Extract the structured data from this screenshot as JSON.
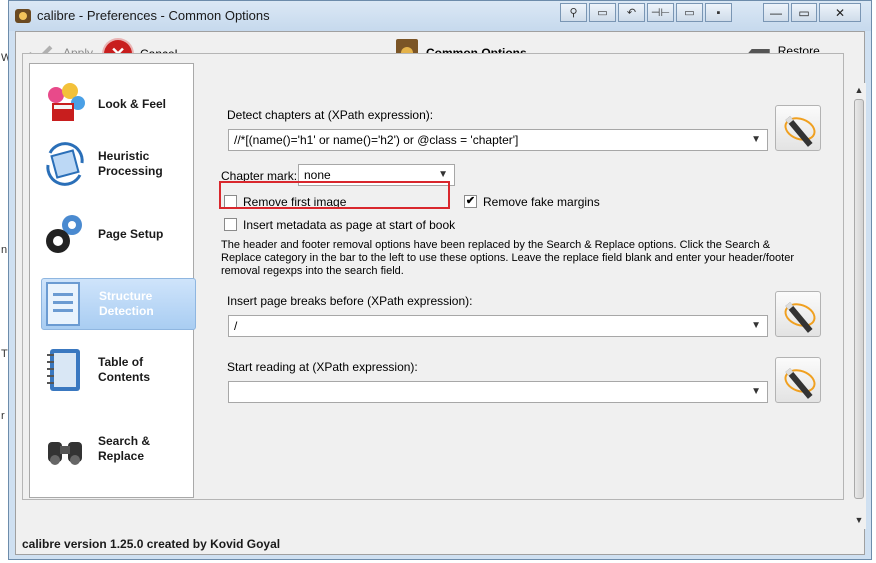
{
  "window": {
    "title": "calibre - Preferences - Common Options",
    "tools": [
      "⚲",
      "▭",
      "↶",
      "⊣⊢",
      "▭",
      "▪"
    ],
    "controls": {
      "minimize": "—",
      "maximize": "▭",
      "close": "✕"
    }
  },
  "toolbar": {
    "apply_label": "Apply",
    "cancel_label": "Cancel",
    "section_title": "Common Options",
    "restore_label": "Restore defaults"
  },
  "sidebar": {
    "items": [
      {
        "label": "Look & Feel"
      },
      {
        "label": "Heuristic Processing"
      },
      {
        "label": "Page Setup"
      },
      {
        "label": "Structure Detection",
        "selected": true
      },
      {
        "label": "Table of Contents"
      },
      {
        "label": "Search & Replace"
      }
    ]
  },
  "form": {
    "detect_chapters_label": "Detect chapters at (XPath expression):",
    "detect_chapters_value": "//*[(name()='h1' or name()='h2') or @class = 'chapter']",
    "chapter_mark_label": "Chapter mark:",
    "chapter_mark_value": "none",
    "remove_first_image_label": "Remove first image",
    "remove_fake_margins_label": "Remove fake margins",
    "insert_metadata_label": "Insert metadata as page at start of book",
    "notice": "The header and footer removal options have been replaced by the Search & Replace options. Click the Search & Replace category in the bar to the left to use these options. Leave the replace field blank and enter your header/footer removal regexps into the search field.",
    "page_breaks_label": "Insert page breaks before (XPath expression):",
    "page_breaks_value": "/",
    "start_reading_label": "Start reading at (XPath expression):",
    "start_reading_value": ""
  },
  "checkbox_marks": {
    "checked": "✔"
  },
  "scrollbar": {
    "up": "▲",
    "down": "▼"
  },
  "status": "calibre version 1.25.0 created by Kovid Goyal",
  "background_fragments": {
    "left_letters": [
      "W",
      "n",
      "T",
      "r"
    ]
  },
  "colors": {
    "highlight": "#d9272d",
    "selected_bg": "#a9cdf2",
    "cancel_red": "#c81e1e"
  }
}
